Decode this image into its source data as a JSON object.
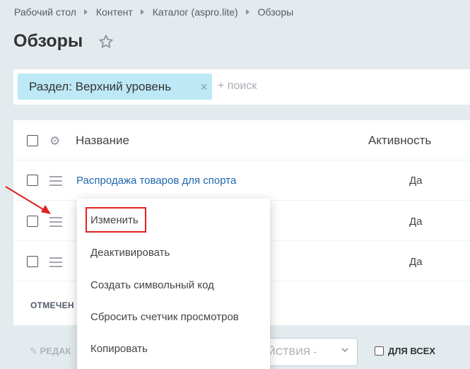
{
  "breadcrumb": [
    "Рабочий стол",
    "Контент",
    "Каталог (aspro.lite)",
    "Обзоры"
  ],
  "page_title": "Обзоры",
  "filter": {
    "chip_label": "Раздел: Верхний уровень",
    "chip_close": "×",
    "search_placeholder": "+ поиск"
  },
  "grid": {
    "header": {
      "name": "Название",
      "active": "Активность"
    },
    "rows": [
      {
        "name": "Распродажа товаров для спорта",
        "active": "Да"
      },
      {
        "name": "",
        "active": "Да"
      },
      {
        "name": "",
        "active": "Да"
      }
    ],
    "marked_label": "ОТМЕЧЕН"
  },
  "footer": {
    "edit_label": "РЕДАК",
    "actions_label": "ЕЙСТВИЯ -",
    "for_all_label": "ДЛЯ ВСЕХ"
  },
  "context_menu": {
    "items": [
      "Изменить",
      "Деактивировать",
      "Создать символьный код",
      "Сбросить счетчик просмотров",
      "Копировать"
    ]
  },
  "colors": {
    "background": "#e4ebee",
    "chip": "#bde8f5",
    "link": "#2067b0",
    "highlight": "#e02020"
  }
}
